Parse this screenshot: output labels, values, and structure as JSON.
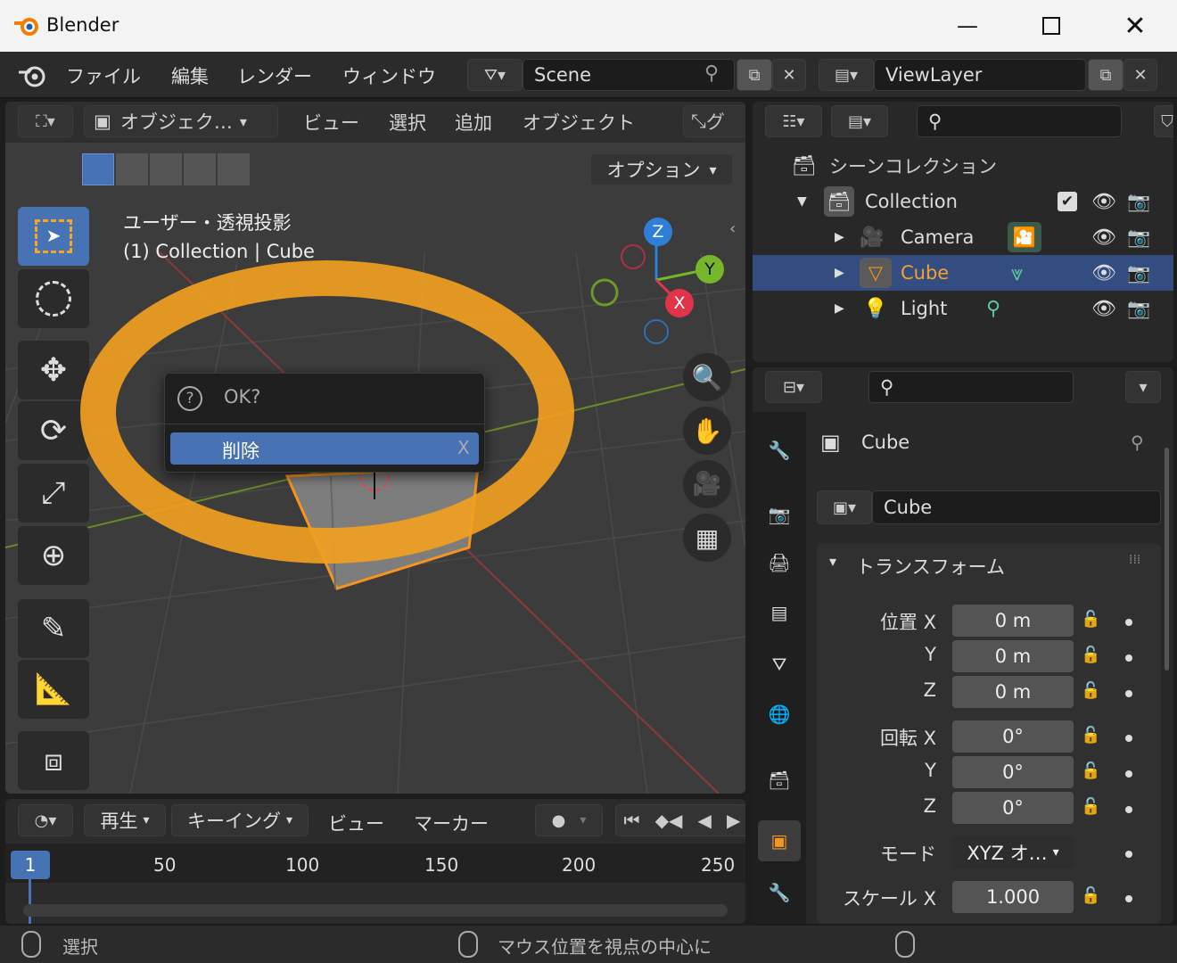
{
  "window": {
    "title": "Blender"
  },
  "topbar": {
    "menus": [
      "ファイル",
      "編集",
      "レンダー",
      "ウィンドウ"
    ],
    "scene": "Scene",
    "view_layer": "ViewLayer"
  },
  "viewport": {
    "mode": "オブジェク…",
    "menus": [
      "ビュー",
      "選択",
      "追加",
      "オブジェクト"
    ],
    "transform_partial": "グ",
    "options": "オプション",
    "view_name": "ユーザー・透視投影",
    "view_sub": "(1) Collection | Cube",
    "gizmo": {
      "x": "X",
      "y": "Y",
      "z": "Z"
    }
  },
  "popup": {
    "title": "OK?",
    "item": "削除",
    "shortcut": "X"
  },
  "outliner": {
    "scene_collection": "シーンコレクション",
    "collection": "Collection",
    "items": [
      "Camera",
      "Cube",
      "Light"
    ]
  },
  "properties": {
    "object_name": "Cube",
    "object_field": "Cube",
    "panel": "トランスフォーム",
    "location_label": "位置 X",
    "y_label": "Y",
    "z_label": "Z",
    "rotation_label": "回転 X",
    "mode_label": "モード",
    "scale_label": "スケール X",
    "location": [
      "0 m",
      "0 m",
      "0 m"
    ],
    "rotation": [
      "0°",
      "0°",
      "0°"
    ],
    "mode": "XYZ オ…",
    "scale_x": "1.000"
  },
  "timeline": {
    "menus": [
      "再生",
      "キーイング",
      "ビュー",
      "マーカー"
    ],
    "current_frame": "1",
    "ticks": [
      "50",
      "100",
      "150",
      "200",
      "250"
    ]
  },
  "statusbar": {
    "left": "選択",
    "middle": "マウス位置を視点の中心に"
  },
  "colors": {
    "accent": "#4772b3",
    "highlight": "#f0a020",
    "selected_row": "#334d80"
  }
}
